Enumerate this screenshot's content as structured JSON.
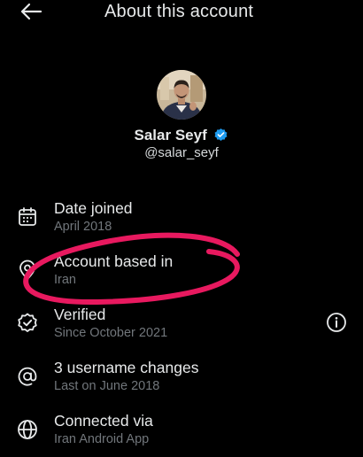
{
  "header": {
    "title": "About this account",
    "back_icon": "arrow-left-icon"
  },
  "profile": {
    "name": "Salar Seyf",
    "handle": "@salar_seyf",
    "verified": true,
    "verified_color": "#1d9bf0"
  },
  "details": [
    {
      "icon": "calendar-icon",
      "title": "Date joined",
      "subtitle": "April 2018"
    },
    {
      "icon": "location-pin-icon",
      "title": "Account based in",
      "subtitle": "Iran"
    },
    {
      "icon": "verified-badge-icon",
      "title": "Verified",
      "subtitle": "Since October 2021"
    },
    {
      "icon": "at-sign-icon",
      "title": "3 username changes",
      "subtitle": "Last on June 2018"
    },
    {
      "icon": "globe-icon",
      "title": "Connected via",
      "subtitle": "Iran Android App"
    }
  ],
  "annotation": {
    "shape": "hand-drawn ellipse",
    "color": "#e8195f",
    "target": "Account based in"
  },
  "colors": {
    "background": "#000000",
    "primary_text": "#e7e9ea",
    "secondary_text": "#71767b",
    "accent": "#1d9bf0"
  }
}
